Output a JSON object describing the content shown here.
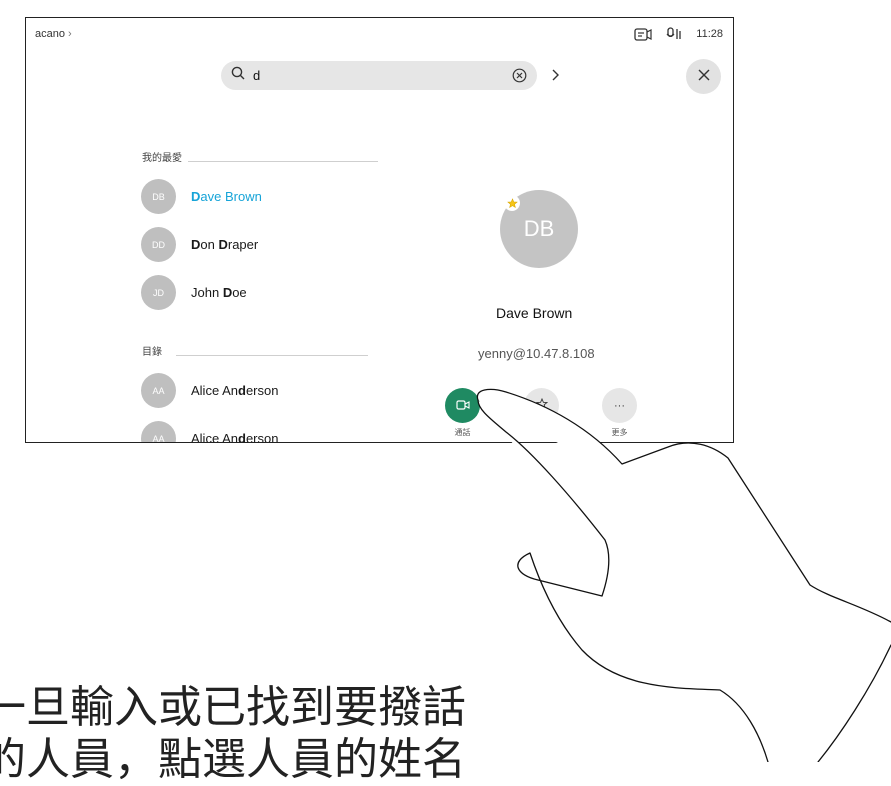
{
  "header": {
    "breadcrumb": "acano",
    "time": "11:28"
  },
  "search": {
    "value": "d"
  },
  "sections": {
    "favorites": "我的最愛",
    "directory": "目錄"
  },
  "favorites": [
    {
      "initials": "DB",
      "name": "Dave Brown",
      "selected": true
    },
    {
      "initials": "DD",
      "name": "Don Draper",
      "selected": false
    },
    {
      "initials": "JD",
      "name": "John Doe",
      "selected": false
    }
  ],
  "directory": [
    {
      "initials": "AA",
      "name": "Alice Anderson"
    },
    {
      "initials": "AA",
      "name": "Alice Anderson"
    }
  ],
  "detail": {
    "initials": "DB",
    "name": "Dave Brown",
    "address": "yenny@10.47.8.108",
    "actions": {
      "call_label": "通話",
      "more_label": "更多",
      "more_glyph": "···"
    }
  },
  "caption": {
    "line1": "一旦輸入或已找到要撥話",
    "line2": "的人員，點選人員的姓名"
  },
  "colors": {
    "accent": "#16a4d8",
    "call": "#1f8a62",
    "avatar": "#bfbfbf",
    "search_bg": "#e6e6e6"
  }
}
